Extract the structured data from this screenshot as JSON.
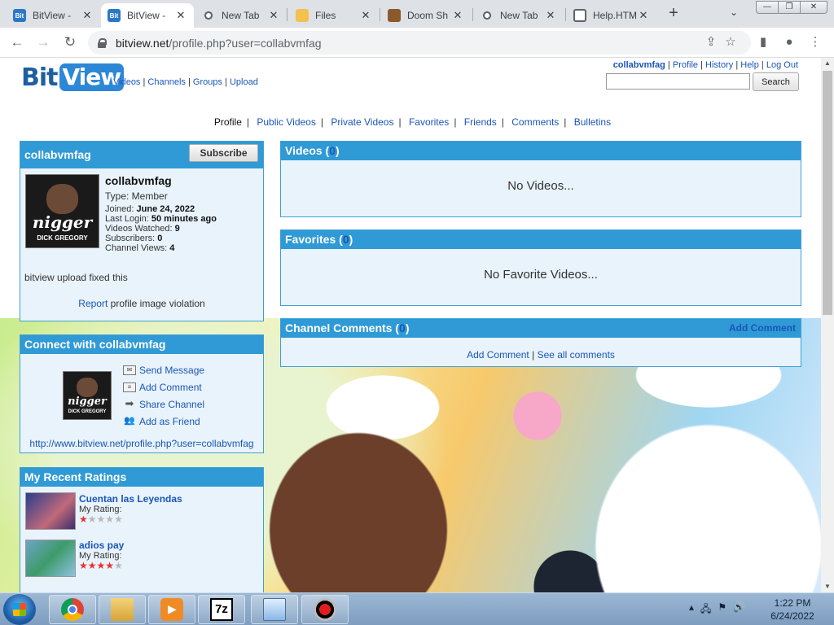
{
  "browser": {
    "tabs": [
      {
        "title": "BitView -",
        "icon": "bitview-favicon",
        "active": false
      },
      {
        "title": "BitView -",
        "icon": "bitview-favicon",
        "active": true
      },
      {
        "title": "New Tab",
        "icon": "chrome-icon",
        "active": false
      },
      {
        "title": "Files",
        "icon": "folder-icon",
        "active": false
      },
      {
        "title": "Doom Sh",
        "icon": "doom-icon",
        "active": false
      },
      {
        "title": "New Tab",
        "icon": "chrome-icon",
        "active": false
      },
      {
        "title": "Help.HTM",
        "icon": "globe-icon",
        "active": false
      }
    ],
    "url_host": "bitview.net",
    "url_path": "/profile.php?user=collabvmfag"
  },
  "site": {
    "logo_bit": "Bit",
    "logo_view": "View",
    "nav": [
      "Videos",
      "Channels",
      "Groups",
      "Upload"
    ],
    "user_nav": {
      "username": "collabvmfag",
      "links": [
        "Profile",
        "History",
        "Help",
        "Log Out"
      ]
    },
    "search_button": "Search",
    "search_value": ""
  },
  "profile_tabs": {
    "current": "Profile",
    "links": [
      "Public Videos",
      "Private Videos",
      "Favorites",
      "Friends",
      "Comments",
      "Bulletins"
    ]
  },
  "profile": {
    "header": "collabvmfag",
    "subscribe_label": "Subscribe",
    "name": "collabvmfag",
    "type": "Type: Member",
    "joined_label": "Joined:",
    "joined": "June 24, 2022",
    "last_login_label": "Last Login:",
    "last_login": "50 minutes ago",
    "videos_watched_label": "Videos Watched:",
    "videos_watched": "9",
    "subscribers_label": "Subscribers:",
    "subscribers": "0",
    "channel_views_label": "Channel Views:",
    "channel_views": "4",
    "bio": "bitview upload fixed this",
    "report_link": "Report",
    "report_text": "profile image violation",
    "avatar_text_word": "nigger",
    "avatar_text_name": "DICK GREGORY"
  },
  "connect": {
    "header": "Connect with collabvmfag",
    "actions": [
      {
        "label": "Send Message",
        "icon": "envelope-icon"
      },
      {
        "label": "Add Comment",
        "icon": "comment-icon"
      },
      {
        "label": "Share Channel",
        "icon": "share-arrow-icon"
      },
      {
        "label": "Add as Friend",
        "icon": "add-friend-icon"
      }
    ],
    "profile_url": "http://www.bitview.net/profile.php?user=collabvmfag"
  },
  "ratings": {
    "header": "My Recent Ratings",
    "items": [
      {
        "title": "Cuentan las Leyendas",
        "label": "My Rating:",
        "stars": 1,
        "max": 5
      },
      {
        "title": "adios pay",
        "label": "My Rating:",
        "stars": 4,
        "max": 5
      }
    ]
  },
  "videos": {
    "header": "Videos",
    "count": "0",
    "empty": "No Videos..."
  },
  "favorites": {
    "header": "Favorites",
    "count": "0",
    "empty": "No Favorite Videos..."
  },
  "comments": {
    "header": "Channel Comments",
    "count": "0",
    "add_comment_header": "Add Comment",
    "add_comment": "Add Comment",
    "see_all": "See all comments"
  },
  "taskbar": {
    "clock_time": "1:22 PM",
    "clock_date": "6/24/2022",
    "task_7z": "7z"
  }
}
